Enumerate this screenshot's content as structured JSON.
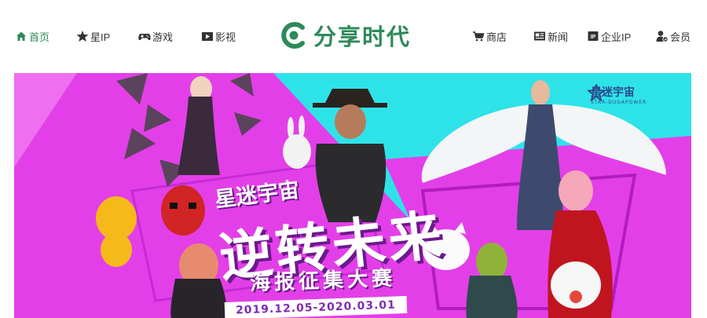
{
  "nav_left": [
    {
      "label": "首页",
      "icon": "home-icon"
    },
    {
      "label": "星IP",
      "icon": "star-icon"
    },
    {
      "label": "游戏",
      "icon": "gamepad-icon"
    },
    {
      "label": "影视",
      "icon": "film-icon"
    }
  ],
  "logo": {
    "text": "分享时代",
    "icon": "logo-c-icon"
  },
  "nav_right": [
    {
      "label": "商店",
      "icon": "cart-icon"
    },
    {
      "label": "新闻",
      "icon": "news-icon"
    },
    {
      "label": "企业IP",
      "icon": "ip-icon"
    },
    {
      "label": "会员",
      "icon": "user-icon"
    }
  ],
  "banner": {
    "brand_name": "星迷宇宙",
    "brand_sub": "STAR-DUGAPOWER",
    "subtitle": "星迷宇宙",
    "title": "逆转未来",
    "event": "海报征集大赛",
    "dates": "2019.12.05-2020.03.01"
  },
  "colors": {
    "accent": "#2e8a5a",
    "banner_cyan": "#2ee3e8",
    "banner_magenta": "#e33fe8"
  }
}
